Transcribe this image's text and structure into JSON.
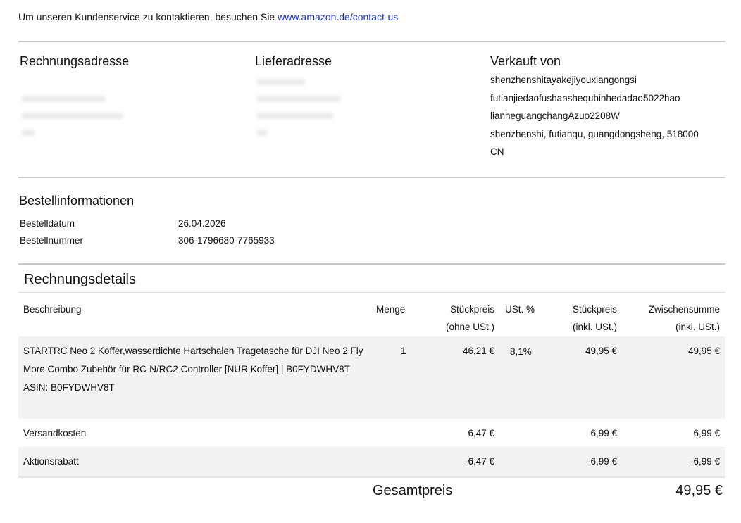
{
  "intro": {
    "text": "Um unseren Kundenservice zu kontaktieren, besuchen Sie ",
    "link": "www.amazon.de/contact-us"
  },
  "addresses": {
    "billing_title": "Rechnungsadresse",
    "shipping_title": "Lieferadresse",
    "seller_title": "Verkauft von",
    "seller_lines": [
      "shenzhenshitayakejiyouxiangongsi",
      "futianjiedaofushanshequbinhedadao5022hao",
      "lianheguangchangAzuo2208W",
      "shenzhenshi, futianqu, guangdongsheng, 518000",
      "CN"
    ]
  },
  "order_info": {
    "title": "Bestellinformationen",
    "date_label": "Bestelldatum",
    "date_value": "26.04.2026",
    "number_label": "Bestellnummer",
    "number_value": "306-1796680-7765933"
  },
  "details": {
    "title": "Rechnungsdetails",
    "headers": {
      "description": "Beschreibung",
      "quantity": "Menge",
      "unit_price_1": "Stückpreis",
      "unit_price_2": "(ohne USt.)",
      "vat": "USt. %",
      "unit_price_incl_1": "Stückpreis",
      "unit_price_incl_2": "(inkl. USt.)",
      "subtotal_1": "Zwischensumme",
      "subtotal_2": "(inkl. USt.)"
    },
    "item": {
      "description": "STARTRC Neo 2 Koffer,wasserdichte Hartschalen Tragetasche für DJI Neo 2 Fly More Combo Zubehör für RC-N/RC2 Controller [NUR Koffer] | B0FYDWHV8T",
      "asin": "ASIN: B0FYDWHV8T",
      "quantity": "1",
      "unit_price": "46,21 €",
      "vat": "8,1%",
      "unit_price_incl": "49,95 €",
      "subtotal": "49,95 €"
    },
    "shipping": {
      "label": "Versandkosten",
      "unit_price": "6,47 €",
      "unit_price_incl": "6,99 €",
      "subtotal": "6,99 €"
    },
    "discount": {
      "label": "Aktionsrabatt",
      "unit_price": "-6,47 €",
      "unit_price_incl": "-6,99 €",
      "subtotal": "-6,99 €"
    },
    "total_label": "Gesamtpreis",
    "total_value": "49,95 €"
  }
}
